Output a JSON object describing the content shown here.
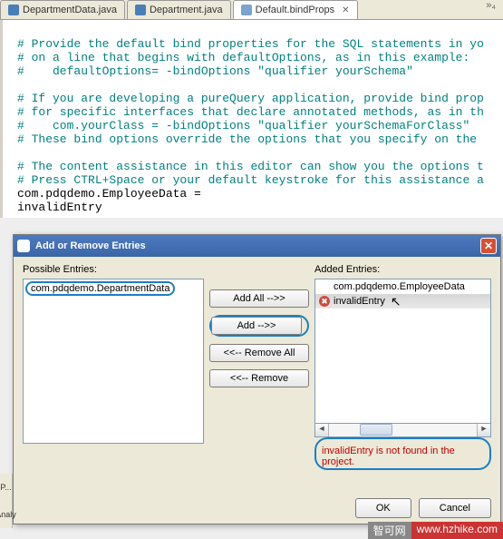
{
  "tabs": {
    "items": [
      {
        "label": "DepartmentData.java",
        "active": false,
        "icon": "java"
      },
      {
        "label": "Department.java",
        "active": false,
        "icon": "java"
      },
      {
        "label": "Default.bindProps",
        "active": true,
        "icon": "text"
      }
    ],
    "close_glyph": "✕",
    "more_glyph": "»₄"
  },
  "editor": {
    "lines": [
      {
        "cls": "comment",
        "text": "# Provide the default bind properties for the SQL statements in yo"
      },
      {
        "cls": "comment",
        "text": "# on a line that begins with defaultOptions, as in this example:"
      },
      {
        "cls": "comment",
        "text": "#    defaultOptions= -bindOptions \"qualifier yourSchema\""
      },
      {
        "cls": "comment",
        "text": ""
      },
      {
        "cls": "comment",
        "text": "# If you are developing a pureQuery application, provide bind prop"
      },
      {
        "cls": "comment",
        "text": "# for specific interfaces that declare annotated methods, as in th"
      },
      {
        "cls": "comment",
        "text": "#    com.yourClass = -bindOptions \"qualifier yourSchemaForClass\""
      },
      {
        "cls": "comment",
        "text": "# These bind options override the options that you specify on the "
      },
      {
        "cls": "comment",
        "text": ""
      },
      {
        "cls": "comment",
        "text": "# The content assistance in this editor can show you the options t"
      },
      {
        "cls": "comment",
        "text": "# Press CTRL+Space or your default keystroke for this assistance a"
      },
      {
        "cls": "plain",
        "text": "com.pdqdemo.EmployeeData ="
      },
      {
        "cls": "plain",
        "text": "invalidEntry"
      }
    ]
  },
  "dialog": {
    "title": "Add or Remove Entries",
    "possible_label": "Possible Entries:",
    "added_label": "Added Entries:",
    "possible_items": [
      "com.pdqdemo.DepartmentData"
    ],
    "added_items": [
      {
        "text": "com.pdqdemo.EmployeeData",
        "error": false,
        "selected": false
      },
      {
        "text": "invalidEntry",
        "error": true,
        "selected": true
      }
    ],
    "buttons": {
      "add_all": "Add All -->>",
      "add": "Add -->>",
      "remove_all": "<<-- Remove All",
      "remove": "<<-- Remove"
    },
    "error_message": "invalidEntry is not found in the project.",
    "ok": "OK",
    "cancel": "Cancel"
  },
  "leftpanel": {
    "a": "P...",
    "b": "Analy"
  },
  "watermark": {
    "a": "智可网",
    "b": "www.hzhike.com"
  }
}
